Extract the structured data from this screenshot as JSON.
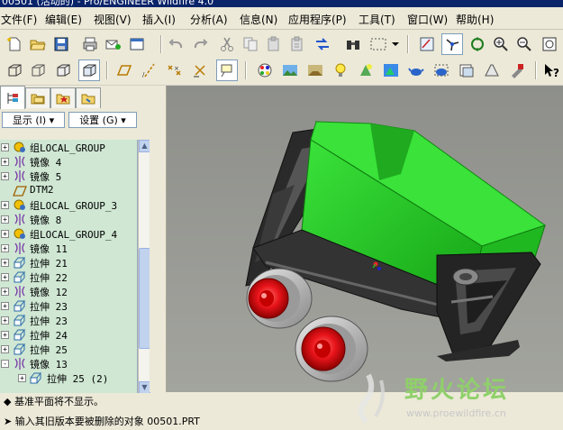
{
  "window": {
    "title": "00501 (活动的) - Pro/ENGINEER Wildfire 4.0"
  },
  "menu": [
    {
      "label": "文件(F)"
    },
    {
      "label": "编辑(E)"
    },
    {
      "label": "视图(V)"
    },
    {
      "label": "插入(I)"
    },
    {
      "label": "分析(A)"
    },
    {
      "label": "信息(N)"
    },
    {
      "label": "应用程序(P)"
    },
    {
      "label": "工具(T)"
    },
    {
      "label": "窗口(W)"
    },
    {
      "label": "帮助(H)"
    }
  ],
  "panel": {
    "tabs": [
      {
        "name": "tab-model-tree",
        "icon": "model-tree-icon"
      },
      {
        "name": "tab-folder-browser",
        "icon": "folder-icon"
      },
      {
        "name": "tab-favorites",
        "icon": "favorites-icon"
      },
      {
        "name": "tab-connections",
        "icon": "connections-icon"
      }
    ],
    "show_label": "显示 (I) ▾",
    "settings_label": "设置 (G) ▾",
    "tree": [
      {
        "label": "组LOCAL_GROUP",
        "icon": "group-icon",
        "expander": "+"
      },
      {
        "label": "镜像 4",
        "icon": "mirror-icon",
        "expander": "+"
      },
      {
        "label": "镜像 5",
        "icon": "mirror-icon",
        "expander": "+"
      },
      {
        "label": "DTM2",
        "icon": "datum-plane-icon",
        "expander": ""
      },
      {
        "label": "组LOCAL_GROUP_3",
        "icon": "group-icon",
        "expander": "+"
      },
      {
        "label": "镜像 8",
        "icon": "mirror-icon",
        "expander": "+"
      },
      {
        "label": "组LOCAL_GROUP_4",
        "icon": "group-icon",
        "expander": "+"
      },
      {
        "label": "镜像 11",
        "icon": "mirror-icon",
        "expander": "+"
      },
      {
        "label": "拉伸 21",
        "icon": "extrude-icon",
        "expander": "+"
      },
      {
        "label": "拉伸 22",
        "icon": "extrude-icon",
        "expander": "+"
      },
      {
        "label": "镜像 12",
        "icon": "mirror-icon",
        "expander": "+"
      },
      {
        "label": "拉伸 23",
        "icon": "extrude-icon",
        "expander": "+"
      },
      {
        "label": "拉伸 23",
        "icon": "extrude-icon",
        "expander": "+"
      },
      {
        "label": "拉伸 24",
        "icon": "extrude-icon",
        "expander": "+"
      },
      {
        "label": "拉伸 25",
        "icon": "extrude-icon",
        "expander": "+"
      },
      {
        "label": "镜像 13",
        "icon": "mirror-icon",
        "expander": "-"
      },
      {
        "label": "拉伸 25 (2)",
        "icon": "extrude-icon",
        "expander": "+"
      }
    ]
  },
  "messages": [
    {
      "text": "基准平面将不显示。"
    },
    {
      "text": "输入其旧版本要被删除的对象  00501.PRT"
    }
  ],
  "watermark": {
    "text": "野火论坛",
    "url": "www.proewildfire.cn"
  },
  "colors": {
    "bucket": "#33d433",
    "wheel": "#e8141a",
    "frame": "#2a2a2a"
  }
}
